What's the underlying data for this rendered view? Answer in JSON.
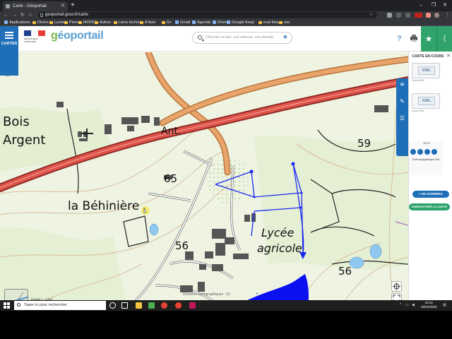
{
  "browser": {
    "tab_title": "Carte - Géoportail",
    "new_tab": "+",
    "url": "geoportail.gouv.fr/carte",
    "bookmarks": [
      {
        "label": "Applications",
        "type": "app"
      },
      {
        "label": "Divers",
        "type": "folder"
      },
      {
        "label": "Lycée",
        "type": "folder"
      },
      {
        "label": "Pierre",
        "type": "folder"
      },
      {
        "label": "MOOC",
        "type": "folder"
      },
      {
        "label": "Autres",
        "type": "folder"
      },
      {
        "label": "Liens techno",
        "type": "folder"
      },
      {
        "label": "A faire",
        "type": "folder"
      },
      {
        "label": "G+",
        "type": "folder"
      },
      {
        "label": "Gmail",
        "type": "app"
      },
      {
        "label": "Agenda",
        "type": "app"
      },
      {
        "label": "Drive",
        "type": "app"
      },
      {
        "label": "Google Keep",
        "type": "app"
      },
      {
        "label": "eval titsa",
        "type": "folder"
      },
      {
        "label": "sac",
        "type": "folder"
      }
    ]
  },
  "site": {
    "menu_label": "CARTES",
    "logo": "géoportail",
    "search_placeholder": "Chercher un lieu, une adresse, une donnée",
    "gov_text": "RÉPUBLIQUE FRANÇAISE"
  },
  "map": {
    "labels": {
      "bois": "Bois",
      "argent": "Argent",
      "behiniere": "la Béhinière",
      "lycee": "Lycée",
      "agricole": "agricole",
      "n65": "65",
      "n59": "59",
      "n56a": "56",
      "n56b": "56",
      "n47": "47",
      "ant": "Ant."
    },
    "scale_text": "Échelle 1 : 4 264",
    "scale_value": "100 m",
    "footer": "Données cartographiques : IG",
    "footer_plus": "+",
    "colors": {
      "road": "#e0554b",
      "road_edge": "#b0302a",
      "orange_road": "#e49a5d",
      "contour": "#d7b28a",
      "water": "#0000ff",
      "drawing": "#0000ff",
      "forest_edge": "#222222"
    }
  },
  "panel": {
    "title": "CARTE EN COURS",
    "layers": [
      {
        "label": "KML",
        "sub": "Import KML"
      },
      {
        "label": "KML",
        "sub": "Import KML"
      }
    ],
    "opacity": "100 %",
    "topo_label": "Carte topographique IGN",
    "add_data": "+ DE DONNÉES",
    "save": "ENREGISTRER LA CARTE"
  },
  "taskbar": {
    "search": "Taper ici pour rechercher",
    "time": "10:22",
    "date": "28/04/2020"
  }
}
